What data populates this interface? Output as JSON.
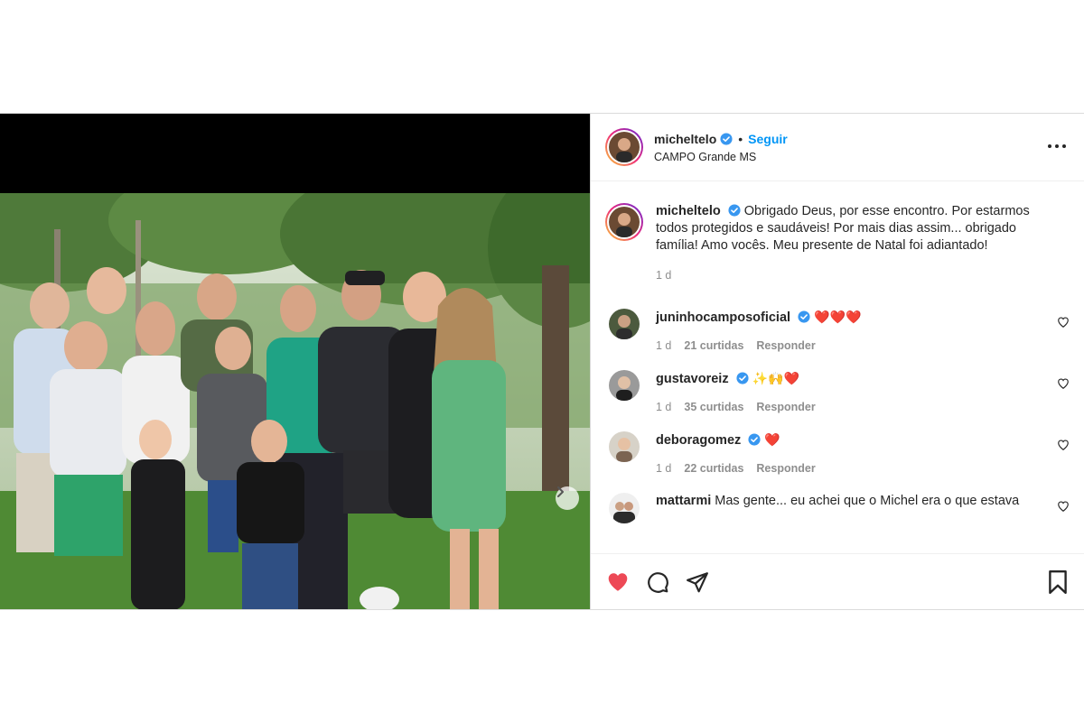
{
  "header": {
    "username": "micheltelo",
    "follow_label": "Seguir",
    "separator": "•",
    "location": "CAMPO Grande MS"
  },
  "caption": {
    "username": "micheltelo",
    "text": "Obrigado Deus, por esse encontro. Por estarmos todos protegidos e saudáveis! Por mais dias assim... obrigado família! Amo vocês. Meu presente de Natal foi adiantado!",
    "time": "1 d"
  },
  "comments": [
    {
      "username": "juninhocamposoficial",
      "verified": true,
      "text": "❤️❤️❤️",
      "time": "1 d",
      "likes": "21 curtidas",
      "reply": "Responder"
    },
    {
      "username": "gustavoreiz",
      "verified": true,
      "text": "✨🙌❤️",
      "time": "1 d",
      "likes": "35 curtidas",
      "reply": "Responder"
    },
    {
      "username": "deboragomez",
      "verified": true,
      "text": "❤️",
      "time": "1 d",
      "likes": "22 curtidas",
      "reply": "Responder"
    },
    {
      "username": "mattarmi",
      "verified": false,
      "text": "Mas gente... eu achei que o Michel era o que estava ",
      "time": "",
      "likes": "",
      "reply": ""
    }
  ],
  "icons": {
    "more": "more-options-icon",
    "next": "chevron-right-icon",
    "like": "heart-filled-icon",
    "comment": "comment-icon",
    "share": "share-icon",
    "save": "bookmark-icon",
    "verified": "verified-badge-icon"
  },
  "colors": {
    "accent": "#0095f6",
    "like": "#ed4956",
    "verified": "#3897f0",
    "muted": "#8e8e8e"
  }
}
